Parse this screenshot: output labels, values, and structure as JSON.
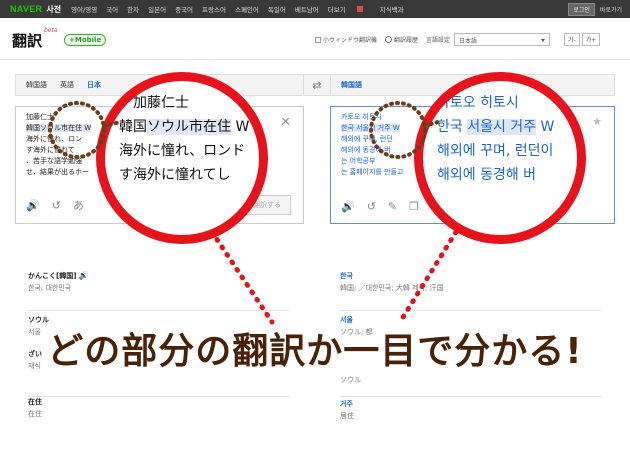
{
  "topbar": {
    "logo": "NAVER",
    "service": "사전",
    "nav": [
      "영어/영영",
      "국어",
      "한자",
      "일본어",
      "중국어",
      "프랑스어",
      "스페인어",
      "독일어",
      "베트남어"
    ],
    "more": "더보기",
    "extra": "지식백과",
    "login": "로그인",
    "shortcut": "바로가기"
  },
  "header": {
    "title": "翻訳",
    "beta": "beta",
    "plus_mobile": "+Mobile",
    "small_window": "小ウィンドウ翻訳機",
    "history": "翻訳履歴",
    "lang_setting": "言語設定",
    "lang_value": "日本語",
    "font_minus": "가-",
    "font_plus": "가+"
  },
  "left": {
    "tabs": [
      "韓国語",
      "英語",
      "日本"
    ],
    "active_tab": 2,
    "source_lines": [
      "加藤仁士",
      "韓国ソウル市在住 W",
      "海外に憧れ、ロン",
      "す海外に憧れて",
      "、苦手な語学勉強",
      "せ、結果が出るホー"
    ],
    "right_fragments": [
      "日々",
      "さ"
    ],
    "translate_button": "翻訳する"
  },
  "right": {
    "tab": "韓国語",
    "target_lines": [
      "카토오 히토시",
      "한국 서울시 거주 W",
      "해외에 꾸며, 런던",
      "해외에 동경해 버",
      "는 어학공부",
      "는 홈페이지를 만들고"
    ],
    "right_fragments": [
      "점",
      "요"
    ]
  },
  "mag_left": {
    "lines": [
      "加藤仁士",
      "韓国ソウル市在住 W",
      "海外に憧れ、ロンド",
      "す海外に憧れてし"
    ],
    "highlight": "ソウル市在住"
  },
  "mag_right": {
    "lines": [
      "카토오 히토시",
      "한국 서울시 거주 W",
      "해외에 꾸며, 런던이",
      "해외에 동경해 버"
    ],
    "highlight": "서울시 거주"
  },
  "dict_left": [
    {
      "hw": "かんこく[韓国]",
      "def": "한국; 대한민국"
    },
    {
      "hw": "ソウル",
      "def": "서울"
    },
    {
      "hw": "ざい",
      "def": "재식"
    },
    {
      "hw": "在住",
      "def": "재주"
    },
    {
      "hw": "",
      "def": "在住"
    }
  ],
  "dict_right": [
    {
      "hw": "한국",
      "def": "韓国; ／대한민국; 大韓 제국; 汗国"
    },
    {
      "hw": "서울",
      "def": "ソウル; 都"
    },
    {
      "hw": "",
      "def": "ソウル"
    },
    {
      "hw": "거주",
      "def": "居住"
    }
  ],
  "banner": "どの部分の翻訳か一目で分かる!",
  "colors": {
    "accent_red": "#e6141a",
    "banner_brown": "#4a2208",
    "naver_green": "#1ec800",
    "link_blue": "#1a67d2"
  }
}
